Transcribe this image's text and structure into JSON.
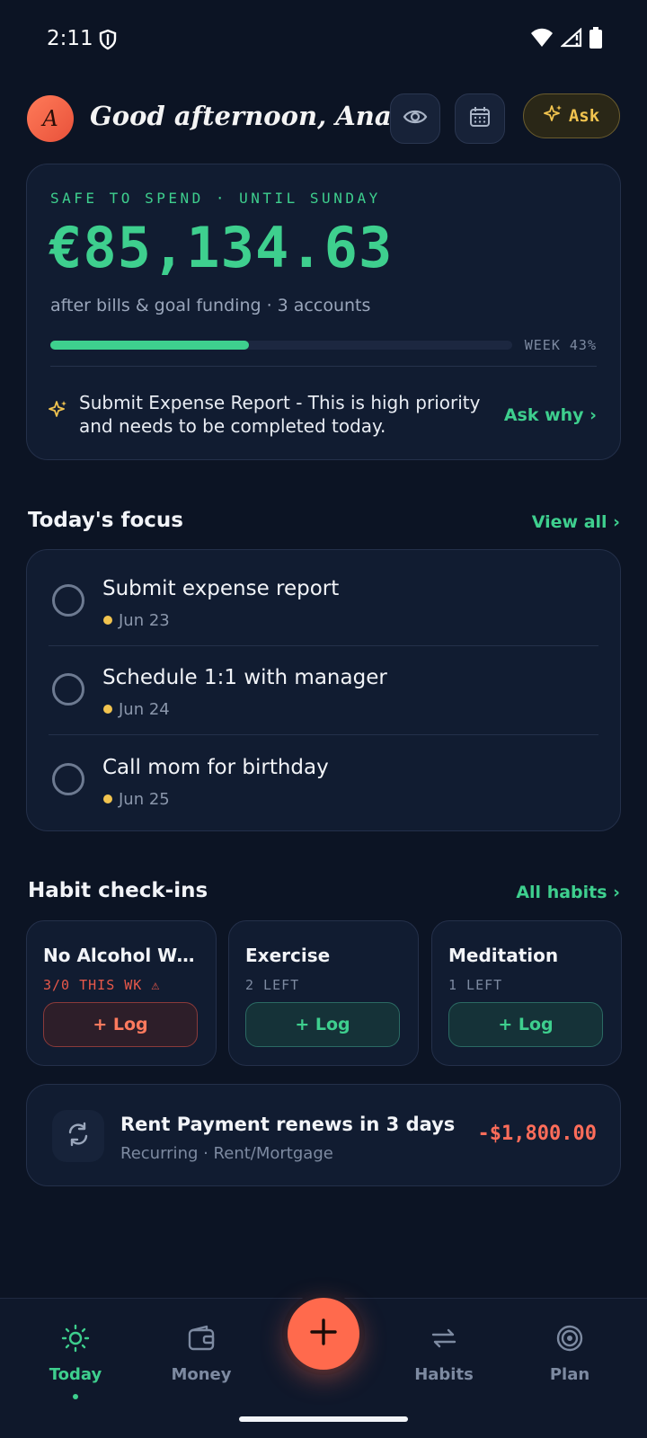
{
  "status_bar": {
    "time": "2:11"
  },
  "header": {
    "avatar_initial": "A",
    "greeting": "Good afternoon, Ana.",
    "ask_label": "Ask"
  },
  "spend": {
    "label": "SAFE TO SPEND · UNTIL SUNDAY",
    "amount": "€85,134.63",
    "subtitle": "after bills & goal funding · 3 accounts",
    "week_label": "WEEK 43%",
    "week_progress": 0.43,
    "tip": "Submit Expense Report - This is high priority and needs to be completed today.",
    "ask_why": "Ask why ›"
  },
  "focus": {
    "title": "Today's focus",
    "view_all": "View all ›",
    "items": [
      {
        "title": "Submit expense report",
        "date": "Jun 23"
      },
      {
        "title": "Schedule 1:1 with manager",
        "date": "Jun 24"
      },
      {
        "title": "Call mom for birthday",
        "date": "Jun 25"
      }
    ]
  },
  "habits": {
    "title": "Habit check-ins",
    "all_link": "All habits ›",
    "items": [
      {
        "title": "No Alcohol Weekdays",
        "status": "3/0 THIS WK ⚠",
        "log": "+ Log"
      },
      {
        "title": "Exercise",
        "status": "2 LEFT",
        "log": "+ Log"
      },
      {
        "title": "Meditation",
        "status": "1 LEFT",
        "log": "+ Log"
      }
    ]
  },
  "rent": {
    "title": "Rent Payment renews in 3 days",
    "subtitle": "Recurring · Rent/Mortgage",
    "amount": "-$1,800.00"
  },
  "nav": {
    "items": [
      {
        "label": "Today",
        "icon": "sun-icon"
      },
      {
        "label": "Money",
        "icon": "wallet-icon"
      },
      {
        "label": "Habits",
        "icon": "repeat-icon"
      },
      {
        "label": "Plan",
        "icon": "target-icon"
      }
    ],
    "fab_icon": "plus-icon"
  },
  "colors": {
    "accent": "#3ecf8e",
    "warning": "#f2c44f",
    "danger": "#ff6d5a",
    "fab": "#ff6a4d",
    "background": "#0c1424"
  }
}
